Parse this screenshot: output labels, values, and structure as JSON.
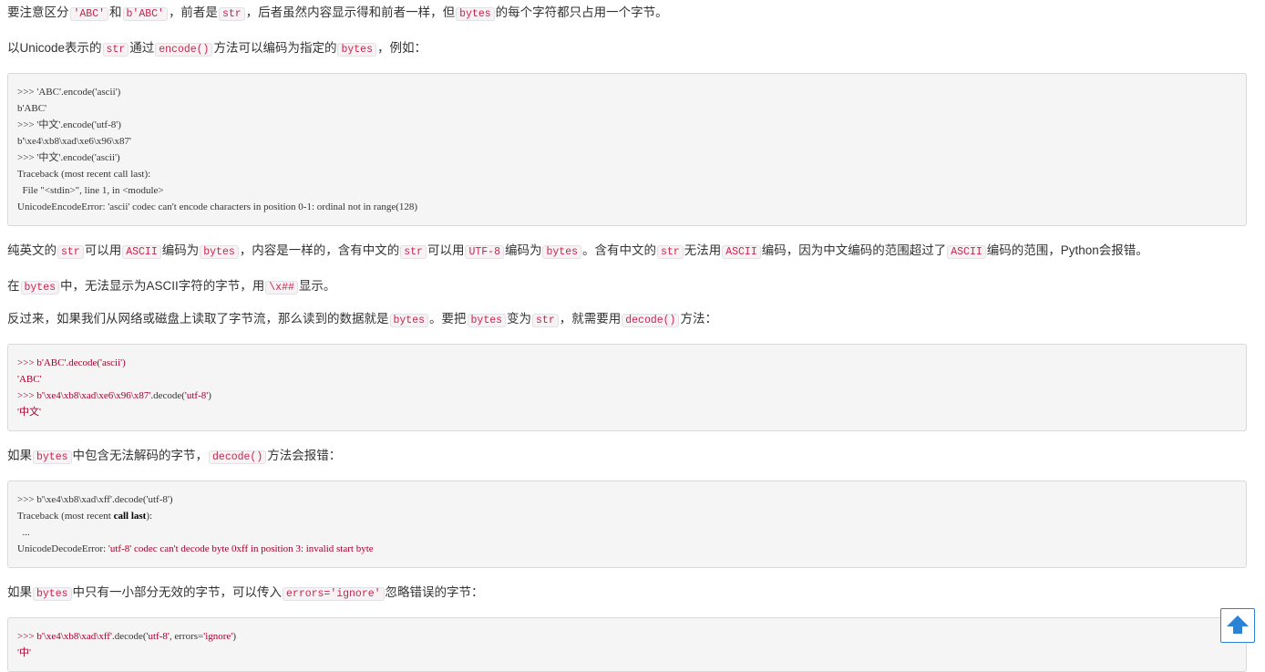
{
  "p1": [
    "要注意区分",
    "'ABC'",
    "和",
    "b'ABC'",
    "，前者是",
    "str",
    "，后者虽然内容显示得和前者一样，但",
    "bytes",
    "的每个字符都只占用一个字节。"
  ],
  "p2": [
    "以Unicode表示的",
    "str",
    "通过",
    "encode()",
    "方法可以编码为指定的",
    "bytes",
    "，例如："
  ],
  "code1": [
    ">>> 'ABC'.encode('ascii')",
    "b'ABC'",
    ">>> '中文'.encode('utf-8')",
    "b'\\xe4\\xb8\\xad\\xe6\\x96\\x87'",
    ">>> '中文'.encode('ascii')",
    "Traceback (most recent call last):",
    "  File \"<stdin>\", line 1, in <module>",
    "UnicodeEncodeError: 'ascii' codec can't encode characters in position 0-1: ordinal not in range(128)"
  ],
  "p3": [
    "纯英文的",
    "str",
    "可以用",
    "ASCII",
    "编码为",
    "bytes",
    "，内容是一样的，含有中文的",
    "str",
    "可以用",
    "UTF-8",
    "编码为",
    "bytes",
    "。含有中文的",
    "str",
    "无法用",
    "ASCII",
    "编码，因为中文编码的范围超过了",
    "ASCII",
    "编码的范围，Python会报错。"
  ],
  "p4": [
    "在",
    "bytes",
    "中，无法显示为ASCII字符的字节，用",
    "\\x##",
    "显示。"
  ],
  "p5": [
    "反过来，如果我们从网络或磁盘上读取了字节流，那么读到的数据就是",
    "bytes",
    "。要把",
    "bytes",
    "变为",
    "str",
    "，就需要用",
    "decode()",
    "方法："
  ],
  "code2": {
    "l1a": ">>> b'ABC'.decode('ascii')",
    "l2": "'ABC'",
    "l3a": ">>> b'\\xe4\\xb8\\xad\\xe6\\x96\\x87'",
    "l3b": ".decode(",
    "l3c": "'utf-8'",
    "l3d": ")",
    "l4": "'中文'"
  },
  "p6": [
    "如果",
    "bytes",
    "中包含无法解码的字节，",
    "decode()",
    "方法会报错："
  ],
  "code3": {
    "l1": ">>> b'\\xe4\\xb8\\xad\\xff'.decode('utf-8')",
    "l2a": "Traceback (most recent ",
    "l2b": "call",
    "l2c": " ",
    "l2d": "last",
    "l2e": "):",
    "l3": "  ...",
    "l4a": "UnicodeDecodeError: ",
    "l4b": "'utf-8'",
    "l4c": " codec can't decode byte 0xff in position 3: invalid start byte"
  },
  "p7": [
    "如果",
    "bytes",
    "中只有一小部分无效的字节，可以传入",
    "errors='ignore'",
    "忽略错误的字节："
  ],
  "code4": {
    "l1a": ">>> b'\\xe4\\xb8\\xad\\xff'",
    "l1b": ".decode(",
    "l1c": "'utf-8'",
    "l1d": ", errors=",
    "l1e": "'ignore'",
    "l1f": ")",
    "l2": "'中'"
  },
  "ui": {
    "scroll_top_icon": "arrow-up-icon",
    "accent": "#2b83d6"
  }
}
